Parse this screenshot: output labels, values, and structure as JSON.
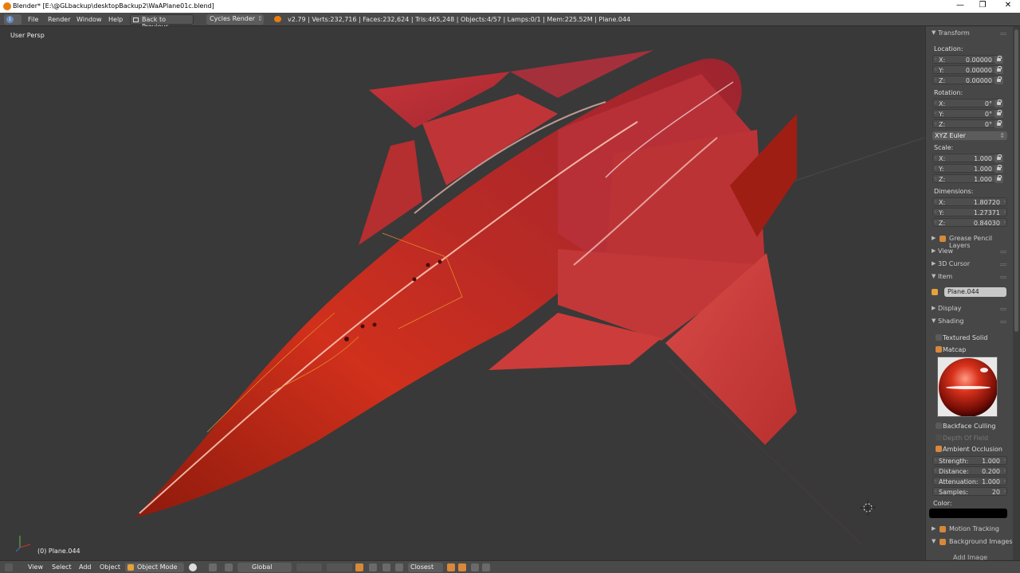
{
  "window": {
    "title": "Blender* [E:\\@GLbackup\\desktopBackup2\\WaAPlane01c.blend]",
    "controls": [
      "—",
      "❐",
      "✕"
    ]
  },
  "menubar": {
    "menus": [
      "File",
      "Render",
      "Window",
      "Help"
    ],
    "back_button": "Back to Previous",
    "render_engine": "Cycles Render",
    "stats": "v2.79 | Verts:232,716 | Faces:232,624 | Tris:465,248 | Objects:4/57 | Lamps:0/1 | Mem:225.52M | Plane.044"
  },
  "viewport": {
    "view_label": "User Persp",
    "object_label": "(0) Plane.044"
  },
  "properties": {
    "transform": {
      "header": "Transform",
      "location_label": "Location:",
      "location": [
        {
          "axis": "X:",
          "value": "0.00000"
        },
        {
          "axis": "Y:",
          "value": "0.00000"
        },
        {
          "axis": "Z:",
          "value": "0.00000"
        }
      ],
      "rotation_label": "Rotation:",
      "rotation": [
        {
          "axis": "X:",
          "value": "0°"
        },
        {
          "axis": "Y:",
          "value": "0°"
        },
        {
          "axis": "Z:",
          "value": "0°"
        }
      ],
      "rotation_mode": "XYZ Euler",
      "scale_label": "Scale:",
      "scale": [
        {
          "axis": "X:",
          "value": "1.000"
        },
        {
          "axis": "Y:",
          "value": "1.000"
        },
        {
          "axis": "Z:",
          "value": "1.000"
        }
      ],
      "dimensions_label": "Dimensions:",
      "dimensions": [
        {
          "axis": "X:",
          "value": "1.80720"
        },
        {
          "axis": "Y:",
          "value": "1.27371"
        },
        {
          "axis": "Z:",
          "value": "0.84030"
        }
      ]
    },
    "grease_pencil": "Grease Pencil Layers",
    "view": "View",
    "cursor3d": "3D Cursor",
    "item": {
      "header": "Item",
      "object_name": "Plane.044"
    },
    "display": "Display",
    "shading": {
      "header": "Shading",
      "textured_solid": "Textured Solid",
      "matcap": "Matcap",
      "backface_culling": "Backface Culling",
      "depth_of_field": "Depth Of Field",
      "ambient_occlusion": "Ambient Occlusion",
      "ao_fields": [
        {
          "label": "Strength:",
          "value": "1.000"
        },
        {
          "label": "Distance:",
          "value": "0.200"
        },
        {
          "label": "Attenuation:",
          "value": "1.000"
        },
        {
          "label": "Samples:",
          "value": "20"
        }
      ],
      "color_label": "Color:"
    },
    "motion_tracking": "Motion Tracking",
    "background_images": "Background Images",
    "add_image": "Add Image"
  },
  "bottombar": {
    "menus": [
      "View",
      "Select",
      "Add",
      "Object"
    ],
    "mode": "Object Mode",
    "orientation": "Global",
    "snap": "Closest"
  },
  "colors": {
    "accent": "#d7883a",
    "panel": "#474747",
    "viewport": "#393939",
    "model_red": "#c8302a"
  }
}
